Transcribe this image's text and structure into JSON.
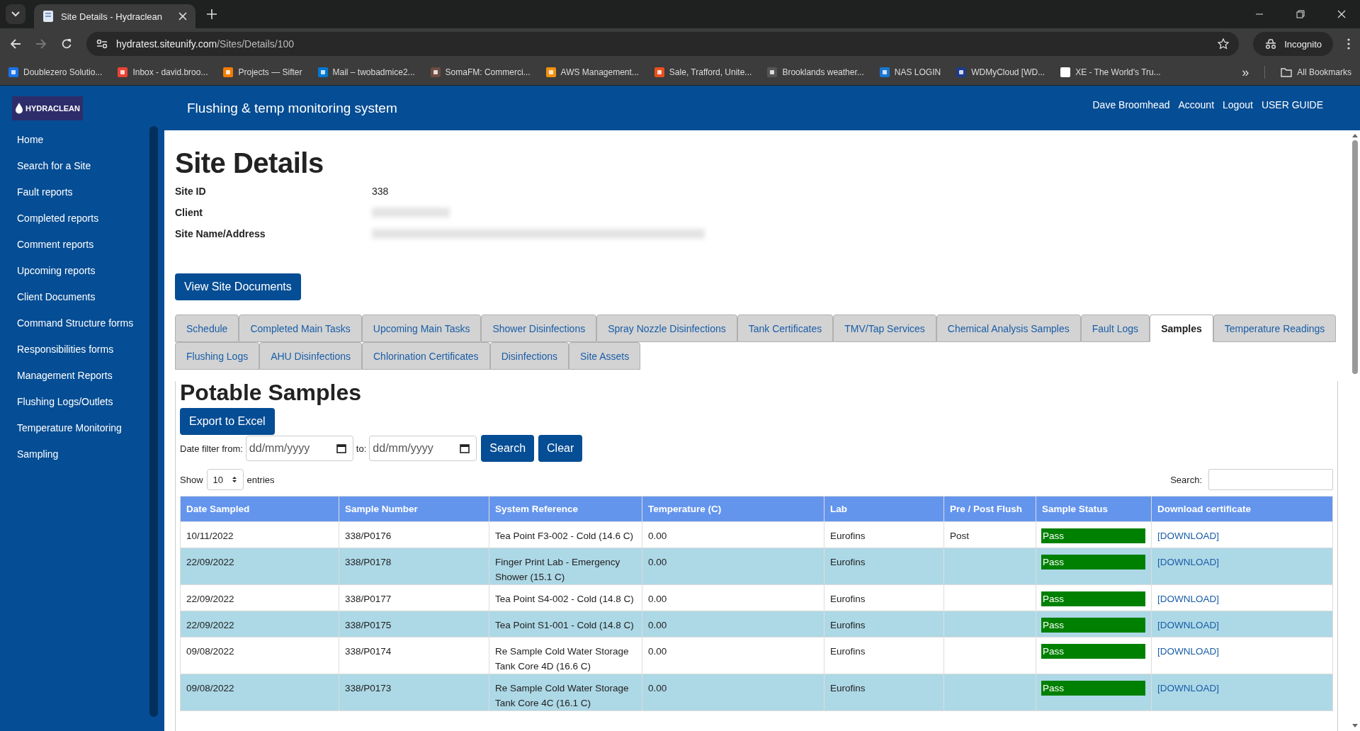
{
  "browser": {
    "tab_title": "Site Details - Hydraclean",
    "url_host": "hydratest.siteunify.com",
    "url_path": "/Sites/Details/100",
    "profile": "Incognito",
    "bookmarks": [
      "Doublezero Solutio...",
      "Inbox - david.broo...",
      "Projects — Sifter",
      "Mail – twobadmice2...",
      "SomaFM: Commerci...",
      "AWS Management...",
      "Sale, Trafford, Unite...",
      "Brooklands weather...",
      "NAS LOGIN",
      "WDMyCloud [WD...",
      "XE - The World's Tru..."
    ],
    "overflow": "»",
    "all_bookmarks": "All Bookmarks"
  },
  "header": {
    "logo": "HYDRACLEAN",
    "title": "Flushing & temp monitoring system",
    "links": [
      "Dave Broomhead",
      "Account",
      "Logout",
      "USER GUIDE"
    ]
  },
  "sidebar": {
    "items": [
      "Home",
      "Search for a Site",
      "Fault reports",
      "Completed reports",
      "Comment reports",
      "Upcoming reports",
      "Client Documents",
      "Command Structure forms",
      "Responsibilities forms",
      "Management Reports",
      "Flushing Logs/Outlets",
      "Temperature Monitoring",
      "Sampling"
    ]
  },
  "page": {
    "title": "Site Details",
    "details": [
      {
        "label": "Site ID",
        "value": "338",
        "redacted": false
      },
      {
        "label": "Client",
        "redacted": true
      },
      {
        "label": "Site Name/Address",
        "redacted": true
      }
    ],
    "documents_button": "View Site Documents",
    "tabs": [
      [
        {
          "label": "Schedule",
          "selected": false
        },
        {
          "label": "Completed Main Tasks",
          "selected": false
        },
        {
          "label": "Upcoming Main Tasks",
          "selected": false
        },
        {
          "label": "Shower Disinfections",
          "selected": false
        },
        {
          "label": "Spray Nozzle Disinfections",
          "selected": false
        },
        {
          "label": "Tank Certificates",
          "selected": false
        },
        {
          "label": "TMV/Tap Services",
          "selected": false
        },
        {
          "label": "Chemical Analysis Samples",
          "selected": false
        },
        {
          "label": "Fault Logs",
          "selected": false
        },
        {
          "label": "Samples",
          "selected": true
        },
        {
          "label": "Temperature Readings",
          "selected": false
        }
      ],
      [
        {
          "label": "Flushing Logs",
          "selected": false
        },
        {
          "label": "AHU Disinfections",
          "selected": false
        },
        {
          "label": "Chlorination Certificates",
          "selected": false
        },
        {
          "label": "Disinfections",
          "selected": false
        },
        {
          "label": "Site Assets",
          "selected": false
        }
      ]
    ]
  },
  "samples": {
    "title": "Potable Samples",
    "export_button": "Export to Excel",
    "filter": {
      "from_label": "Date filter from:",
      "from_placeholder": "dd/mm/yyyy",
      "to_label": "to:",
      "to_placeholder": "dd/mm/yyyy",
      "search_button": "Search",
      "clear_button": "Clear"
    },
    "show_label": "Show",
    "page_size": "10",
    "entries_label": "entries",
    "search_label": "Search:",
    "table": {
      "columns": [
        "Date Sampled",
        "Sample Number",
        "System Reference",
        "Temperature (C)",
        "Lab",
        "Pre / Post Flush",
        "Sample Status",
        "Download certificate"
      ],
      "rows": [
        {
          "date": "10/11/2022",
          "number": "338/P0176",
          "reference": "Tea Point F3-002 - Cold (14.6 C)",
          "temperature": "0.00",
          "lab": "Eurofins",
          "flush": "Post",
          "status": "Pass",
          "kind": "pass",
          "link": "[DOWNLOAD]"
        },
        {
          "date": "22/09/2022",
          "number": "338/P0178",
          "reference": "Finger Print Lab - Emergency Shower (15.1 C)",
          "temperature": "0.00",
          "lab": "Eurofins",
          "status": "Pass",
          "kind": "pass",
          "link": "[DOWNLOAD]"
        },
        {
          "date": "22/09/2022",
          "number": "338/P0177",
          "reference": "Tea Point S4-002 - Cold (14.8 C)",
          "temperature": "0.00",
          "lab": "Eurofins",
          "status": "Pass",
          "kind": "pass",
          "link": "[DOWNLOAD]"
        },
        {
          "date": "22/09/2022",
          "number": "338/P0175",
          "reference": "Tea Point S1-001 - Cold (14.8 C)",
          "temperature": "0.00",
          "lab": "Eurofins",
          "status": "Pass",
          "kind": "pass",
          "link": "[DOWNLOAD]"
        },
        {
          "date": "09/08/2022",
          "number": "338/P0174",
          "reference": "Re Sample Cold Water Storage Tank Core 4D (16.6 C)",
          "temperature": "0.00",
          "lab": "Eurofins",
          "status": "Pass",
          "kind": "pass",
          "link": "[DOWNLOAD]"
        },
        {
          "date": "09/08/2022",
          "number": "338/P0173",
          "reference": "Re Sample Cold Water Storage Tank Core 4C (16.1 C)",
          "temperature": "0.00",
          "lab": "Eurofins",
          "status": "Pass",
          "kind": "pass",
          "link": "[DOWNLOAD]"
        }
      ]
    }
  }
}
